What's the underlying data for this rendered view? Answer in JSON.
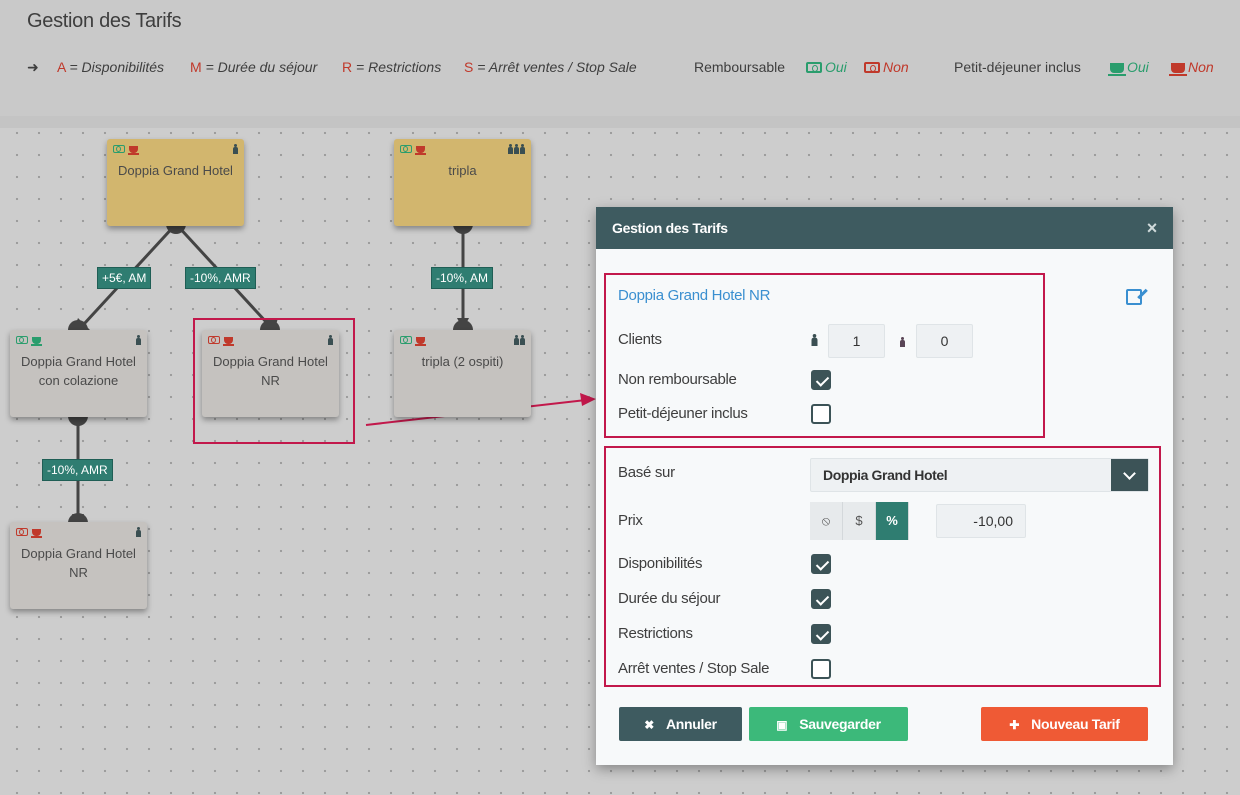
{
  "header": {
    "title": "Gestion des Tarifs",
    "legend": {
      "a_letter": "A",
      "a_text": "= Disponibilités",
      "m_letter": "M",
      "m_text": "= Durée du séjour",
      "r_letter": "R",
      "r_text": "= Restrictions",
      "s_letter": "S",
      "s_text": "= Arrêt ventes / Stop Sale",
      "refundable_label": "Remboursable",
      "refundable_yes": "Oui",
      "refundable_no": "Non",
      "breakfast_label": "Petit-déjeuner inclus",
      "breakfast_yes": "Oui",
      "breakfast_no": "Non"
    }
  },
  "canvas": {
    "nodes": [
      {
        "label": "Doppia Grand Hotel"
      },
      {
        "label": "tripla"
      },
      {
        "label": "Doppia Grand Hotel con colazione"
      },
      {
        "label": "Doppia Grand Hotel NR"
      },
      {
        "label": "tripla (2 ospiti)"
      },
      {
        "label": "Doppia Grand Hotel NR"
      }
    ],
    "edges": [
      {
        "label": "+5€, AM"
      },
      {
        "label": "-10%, AMR"
      },
      {
        "label": "-10%, AM"
      },
      {
        "label": "-10%, AMR"
      }
    ]
  },
  "modal": {
    "title": "Gestion des Tarifs",
    "close": "×",
    "rate_name": "Doppia Grand Hotel NR",
    "clients_label": "Clients",
    "adults": "1",
    "children": "0",
    "non_refundable_label": "Non remboursable",
    "non_refundable_checked": true,
    "breakfast_label": "Petit-déjeuner inclus",
    "breakfast_checked": false,
    "based_on_label": "Basé sur",
    "based_on_value": "Doppia Grand Hotel",
    "price_label": "Prix",
    "price_modes": [
      "⦸",
      "$",
      "%"
    ],
    "price_mode_active": "%",
    "price_value": "-10,00",
    "availability_label": "Disponibilités",
    "availability_checked": true,
    "stay_label": "Durée du séjour",
    "stay_checked": true,
    "restrictions_label": "Restrictions",
    "restrictions_checked": true,
    "stop_sale_label": "Arrêt ventes / Stop Sale",
    "stop_sale_checked": false,
    "buttons": {
      "cancel": "Annuler",
      "save": "Sauvegarder",
      "new_rate": "Nouveau Tarif"
    }
  },
  "colors": {
    "modal_header": "#3e5b60",
    "highlight": "#c2184b",
    "edge_label": "#2f7d71",
    "node_root": "#d2b66e",
    "node_child": "#c5c2bf",
    "btn_save": "#3cb97a",
    "btn_new": "#ef5a35"
  }
}
